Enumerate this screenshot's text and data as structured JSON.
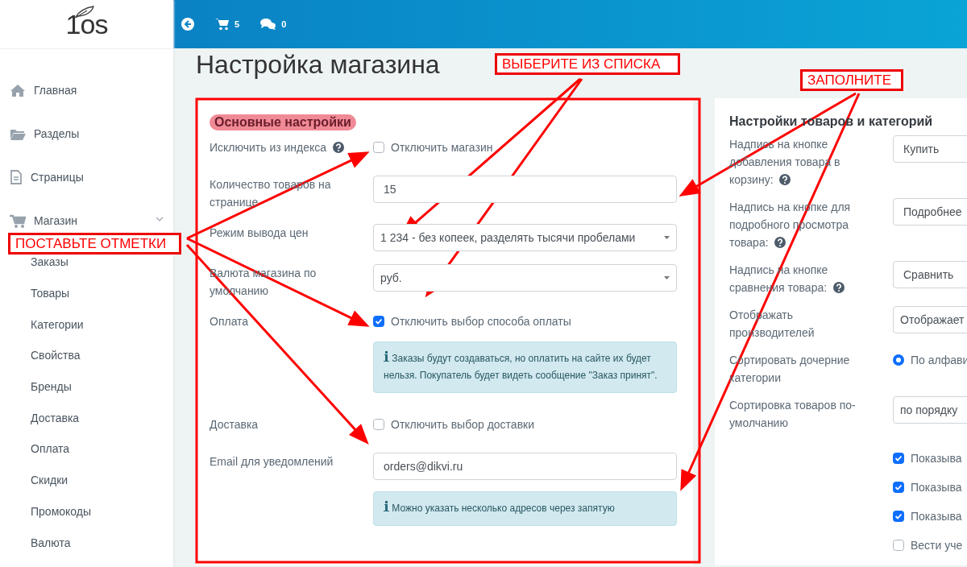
{
  "sidebar": {
    "logo": "1os",
    "items": [
      {
        "label": "Главная"
      },
      {
        "label": "Разделы"
      },
      {
        "label": "Страницы"
      },
      {
        "label": "Магазин",
        "expanded": true,
        "children": [
          "Заказы",
          "Товары",
          "Категории",
          "Свойства",
          "Бренды",
          "Доставка",
          "Оплата",
          "Скидки",
          "Промокоды",
          "Валюта"
        ]
      }
    ]
  },
  "topbar": {
    "cart_count": "5",
    "messages_count": "0"
  },
  "title": "Настройка магазина",
  "main_settings": {
    "heading": "Основные настройки",
    "highlighted": true,
    "rows": [
      {
        "kind": "checkbox",
        "label": "Исключить из индекса",
        "help": true,
        "option": "Отключить магазин",
        "checked": false
      },
      {
        "kind": "input",
        "label": "Количество товаров на странице",
        "value": "15"
      },
      {
        "kind": "select",
        "label": "Режим вывода цен",
        "value": "1 234 - без копеек, разделять тысячи пробелами"
      },
      {
        "kind": "select",
        "label": "Валюта магазина по умолчанию",
        "value": "руб."
      },
      {
        "kind": "checkbox",
        "label": "Оплата",
        "option": "Отключить выбор способа оплаты",
        "checked": true,
        "note": "Заказы будут создаваться, но оплатить на сайте их будет нельзя. Покупатель будет видеть сообщение \"Заказ принят\"."
      },
      {
        "kind": "checkbox",
        "label": "Доставка",
        "option": "Отключить выбор доставки",
        "checked": false
      },
      {
        "kind": "input",
        "label": "Email для уведомлений",
        "value": "orders@dikvi.ru",
        "note": "Можно указать несколько адресов через запятую"
      }
    ]
  },
  "product_settings": {
    "heading": "Настройки товаров и категорий",
    "rows": [
      {
        "kind": "input",
        "label": "Надпись на кнопке добавления товара в корзину:",
        "help": true,
        "value": "Купить"
      },
      {
        "kind": "input",
        "label": "Надпись на кнопке для подробного просмотра товара:",
        "help": true,
        "value": "Подробнее"
      },
      {
        "kind": "input",
        "label": "Надпись на кнопке сравнения товара:",
        "help": true,
        "value": "Сравнить"
      },
      {
        "kind": "select",
        "label": "Отображать производителей",
        "value": "Отображает"
      },
      {
        "kind": "radio",
        "label": "Сортировать дочерние категории",
        "option": "По алфави",
        "selected": true
      },
      {
        "kind": "select",
        "label": "Сортировка товаров по-умолчанию",
        "value": "по порядку"
      },
      {
        "kind": "checkbox",
        "option": "Показыва",
        "checked": true
      },
      {
        "kind": "checkbox",
        "option": "Показыва",
        "checked": true
      },
      {
        "kind": "checkbox",
        "option": "Показыва",
        "checked": true
      },
      {
        "kind": "checkbox",
        "option": "Вести уче",
        "checked": false
      }
    ]
  },
  "annotations": {
    "callouts": [
      {
        "text": "ВЫБЕРИТЕ ИЗ СПИСКА"
      },
      {
        "text": "ЗАПОЛНИТЕ"
      },
      {
        "text": "ПОСТАВЬТЕ ОТМЕТКИ"
      }
    ]
  }
}
